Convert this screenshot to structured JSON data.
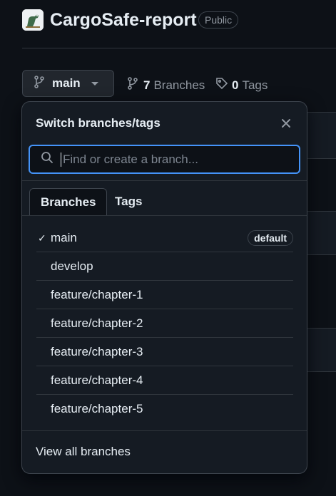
{
  "repo": {
    "name": "CargoSafe-report",
    "visibility": "Public"
  },
  "branch_selector": {
    "current": "main"
  },
  "counts": {
    "branches_count": "7",
    "branches_label": "Branches",
    "tags_count": "0",
    "tags_label": "Tags"
  },
  "dropdown": {
    "title": "Switch branches/tags",
    "search_placeholder": "Find or create a branch...",
    "tabs": [
      {
        "label": "Branches",
        "active": true
      },
      {
        "label": "Tags",
        "active": false
      }
    ],
    "branches": [
      {
        "name": "main",
        "selected": true,
        "badge": "default"
      },
      {
        "name": "develop"
      },
      {
        "name": "feature/chapter-1"
      },
      {
        "name": "feature/chapter-2"
      },
      {
        "name": "feature/chapter-3"
      },
      {
        "name": "feature/chapter-4"
      },
      {
        "name": "feature/chapter-5"
      }
    ],
    "footer_link": "View all branches"
  },
  "colors": {
    "background": "#0d1117",
    "accent": "#4493f8",
    "panel": "#151b23",
    "border": "#3d444d"
  }
}
